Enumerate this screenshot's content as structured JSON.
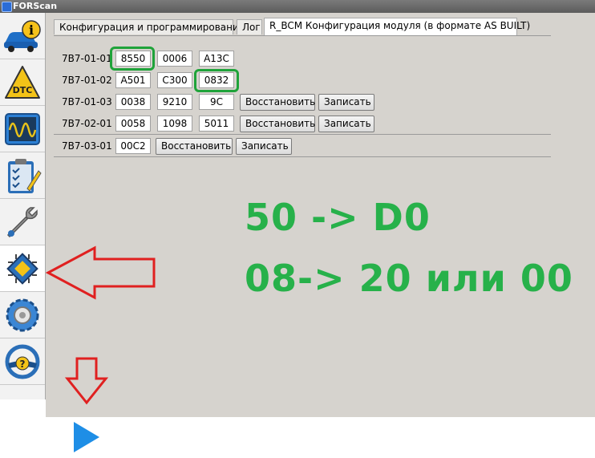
{
  "window": {
    "title": "FORScan"
  },
  "sidebar": {
    "items": [
      {
        "name": "vehicle-info",
        "icon": "car-info-icon"
      },
      {
        "name": "dtc",
        "icon": "dtc-warning-icon",
        "label": "DTC"
      },
      {
        "name": "oscilloscope",
        "icon": "oscilloscope-icon"
      },
      {
        "name": "tests",
        "icon": "checklist-icon"
      },
      {
        "name": "service",
        "icon": "wrench-icon"
      },
      {
        "name": "configuration",
        "icon": "chip-icon",
        "active": true
      },
      {
        "name": "settings",
        "icon": "gear-icon"
      },
      {
        "name": "help",
        "icon": "steering-help-icon",
        "label": "?"
      }
    ]
  },
  "tabs": [
    {
      "label": "Конфигурация и программирование",
      "active": false
    },
    {
      "label": "Лог",
      "active": false
    },
    {
      "label": "R_BCM Конфигурация модуля (в формате AS BUILT)",
      "active": true
    }
  ],
  "rows": [
    {
      "label": "7B7-01-01",
      "cells": [
        "8550",
        "0006",
        "A13C"
      ]
    },
    {
      "label": "7B7-01-02",
      "cells": [
        "A501",
        "C300",
        "0832"
      ]
    },
    {
      "label": "7B7-01-03",
      "cells": [
        "0038",
        "9210",
        "9C"
      ],
      "restore_label": "Восстановить",
      "write_label": "Записать"
    },
    {
      "label": "7B7-02-01",
      "cells": [
        "0058",
        "1098",
        "5011"
      ],
      "restore_label": "Восстановить",
      "write_label": "Записать"
    },
    {
      "label": "7B7-03-01",
      "cells": [
        "00C2"
      ],
      "restore_label": "Восстановить",
      "write_label": "Записать"
    }
  ],
  "annotations": {
    "line1": "50 -> D0",
    "line2": "08-> 20 или 00",
    "text_color": "#27b14a",
    "highlight_color": "#1fa33a",
    "arrow_color": "#e02020"
  },
  "colors": {
    "play": "#1e8ee6",
    "panel": "#d6d3ce"
  }
}
